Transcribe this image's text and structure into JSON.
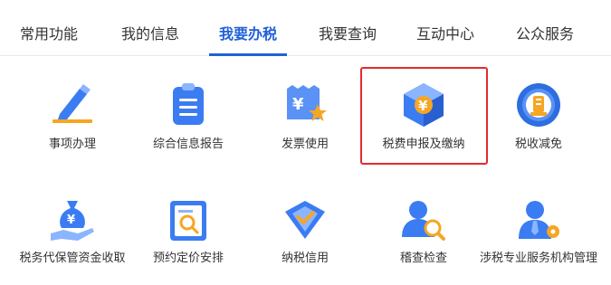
{
  "tabs": [
    {
      "label": "常用功能",
      "active": false
    },
    {
      "label": "我的信息",
      "active": false
    },
    {
      "label": "我要办税",
      "active": true
    },
    {
      "label": "我要查询",
      "active": false
    },
    {
      "label": "互动中心",
      "active": false
    },
    {
      "label": "公众服务",
      "active": false
    }
  ],
  "tiles": [
    {
      "label": "事项办理",
      "icon": "pen-icon"
    },
    {
      "label": "综合信息报告",
      "icon": "clipboard-list-icon"
    },
    {
      "label": "发票使用",
      "icon": "invoice-yen-star-icon"
    },
    {
      "label": "税费申报及缴纳",
      "icon": "yen-cube-icon"
    },
    {
      "label": "税收减免",
      "icon": "tax-emblem-icon"
    },
    {
      "label": "税务代保管资金收取",
      "icon": "money-bag-hand-icon"
    },
    {
      "label": "预约定价安排",
      "icon": "document-magnifier-icon"
    },
    {
      "label": "纳税信用",
      "icon": "shield-check-icon"
    },
    {
      "label": "稽查检查",
      "icon": "inspector-magnifier-icon"
    },
    {
      "label": "涉税专业服务机构管理",
      "icon": "agent-gear-icon"
    }
  ],
  "colors": {
    "accent": "#2161d8",
    "highlight": "#e02d2d",
    "icon_blue": "#2f6ff0",
    "icon_orange": "#f5a623"
  }
}
